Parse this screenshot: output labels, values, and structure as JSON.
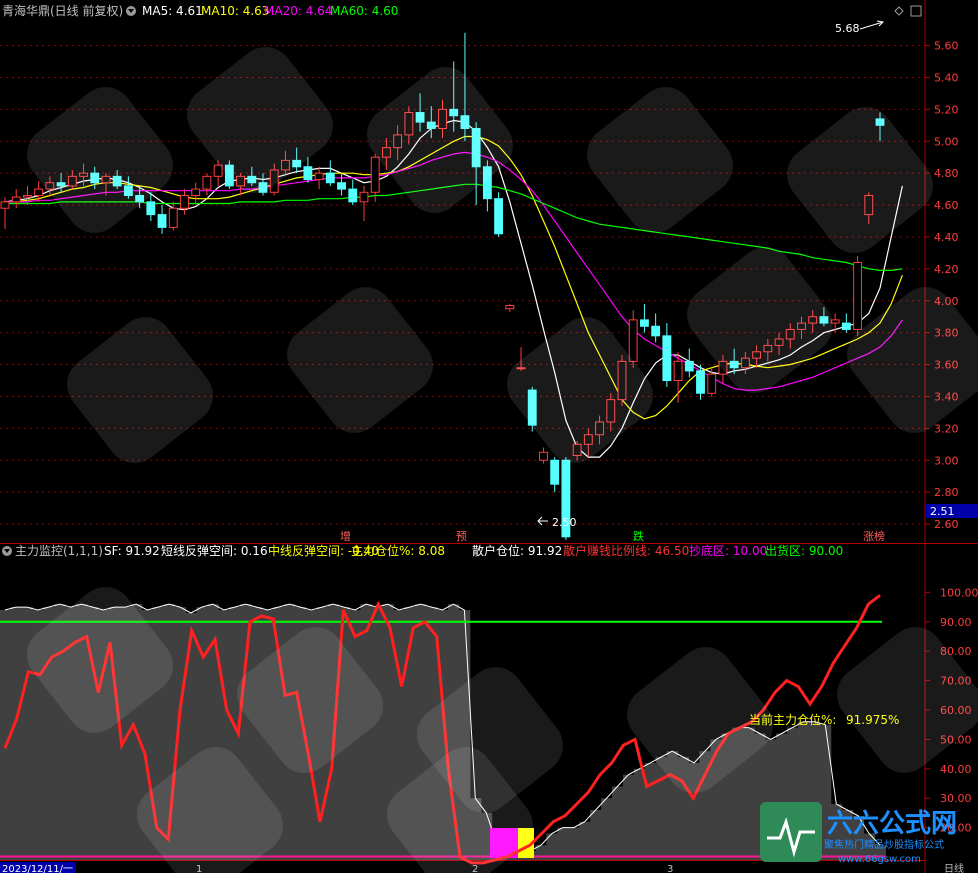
{
  "top_legend": {
    "title": "青海华鼎(日线 前复权)",
    "ma5": "MA5: 4.61",
    "ma10": "MA10: 4.63",
    "ma20": "MA20: 4.64",
    "ma60": "MA60: 4.60"
  },
  "price_panel": {
    "current_price_box": "2.51",
    "high_annotation": "5.68",
    "low_annotation": "2.50",
    "markers": [
      {
        "label": "增"
      },
      {
        "label": "预"
      },
      {
        "label": "跌"
      },
      {
        "label": "涨榜"
      }
    ]
  },
  "indicator_legend": {
    "name": "主力监控(1,1,1)",
    "sf": "SF: 91.92",
    "short_rebound": "短线反弹空间: 0.16",
    "mid_rebound": "中线反弹空间: -0.40",
    "main_position": "主力仓位%: 8.08",
    "retail_position": "散户仓位: 91.92",
    "retail_profit": "散户赚钱比例线: 46.50",
    "bottom_zone": "抄底区: 10.00",
    "sell_zone": "出货区: 90.00"
  },
  "indicator_panel": {
    "current_label": "当前主力仓位%:",
    "current_value": "91.975%"
  },
  "time_axis": {
    "start_date": "2023/12/11/一",
    "ticks": [
      "1",
      "2",
      "3"
    ],
    "period": "日线"
  },
  "brand": {
    "name": "六六公式网",
    "slogan": "聚焦热门精品炒股指标公式",
    "url": "www.66gsw.com"
  },
  "colors": {
    "up": "#ff3c3c",
    "down": "#54ffff",
    "ma5": "#ffffff",
    "ma10": "#ffff00",
    "ma20": "#ff00ff",
    "ma60": "#00ff00",
    "grid": "#8b0000"
  },
  "chart_data": [
    {
      "type": "candlestick",
      "title": "青海华鼎(日线 前复权)",
      "ylim": [
        2.5,
        5.7
      ],
      "yticks": [
        2.6,
        2.8,
        3.0,
        3.2,
        3.4,
        3.6,
        3.8,
        4.0,
        4.2,
        4.4,
        4.6,
        4.8,
        5.0,
        5.2,
        5.4,
        5.6
      ],
      "ohlc": [
        [
          4.58,
          4.65,
          4.45,
          4.62
        ],
        [
          4.62,
          4.7,
          4.58,
          4.65
        ],
        [
          4.65,
          4.72,
          4.6,
          4.66
        ],
        [
          4.66,
          4.75,
          4.62,
          4.7
        ],
        [
          4.7,
          4.78,
          4.65,
          4.74
        ],
        [
          4.74,
          4.8,
          4.68,
          4.72
        ],
        [
          4.72,
          4.82,
          4.7,
          4.78
        ],
        [
          4.78,
          4.86,
          4.72,
          4.8
        ],
        [
          4.8,
          4.84,
          4.7,
          4.74
        ],
        [
          4.74,
          4.8,
          4.66,
          4.78
        ],
        [
          4.78,
          4.82,
          4.7,
          4.72
        ],
        [
          4.72,
          4.78,
          4.64,
          4.66
        ],
        [
          4.66,
          4.72,
          4.58,
          4.62
        ],
        [
          4.62,
          4.68,
          4.5,
          4.54
        ],
        [
          4.54,
          4.6,
          4.42,
          4.46
        ],
        [
          4.46,
          4.62,
          4.44,
          4.58
        ],
        [
          4.58,
          4.7,
          4.54,
          4.66
        ],
        [
          4.66,
          4.74,
          4.6,
          4.7
        ],
        [
          4.7,
          4.8,
          4.66,
          4.78
        ],
        [
          4.78,
          4.88,
          4.72,
          4.85
        ],
        [
          4.85,
          4.88,
          4.7,
          4.72
        ],
        [
          4.72,
          4.8,
          4.66,
          4.78
        ],
        [
          4.78,
          4.84,
          4.72,
          4.74
        ],
        [
          4.74,
          4.8,
          4.66,
          4.68
        ],
        [
          4.68,
          4.86,
          4.66,
          4.82
        ],
        [
          4.82,
          4.94,
          4.78,
          4.88
        ],
        [
          4.88,
          4.96,
          4.8,
          4.84
        ],
        [
          4.84,
          4.9,
          4.74,
          4.76
        ],
        [
          4.76,
          4.84,
          4.7,
          4.8
        ],
        [
          4.8,
          4.88,
          4.72,
          4.74
        ],
        [
          4.74,
          4.8,
          4.66,
          4.7
        ],
        [
          4.7,
          4.76,
          4.6,
          4.62
        ],
        [
          4.62,
          4.72,
          4.5,
          4.68
        ],
        [
          4.68,
          4.92,
          4.62,
          4.9
        ],
        [
          4.9,
          5.02,
          4.82,
          4.96
        ],
        [
          4.96,
          5.1,
          4.88,
          5.04
        ],
        [
          5.04,
          5.22,
          4.98,
          5.18
        ],
        [
          5.18,
          5.3,
          5.06,
          5.12
        ],
        [
          5.12,
          5.22,
          5.02,
          5.08
        ],
        [
          5.08,
          5.26,
          5.02,
          5.2
        ],
        [
          5.2,
          5.5,
          5.06,
          5.16
        ],
        [
          5.16,
          5.68,
          5.0,
          5.08
        ],
        [
          5.08,
          5.12,
          4.6,
          4.84
        ],
        [
          4.84,
          4.88,
          4.56,
          4.64
        ],
        [
          4.64,
          4.68,
          4.4,
          4.42
        ],
        [
          3.95,
          3.98,
          3.93,
          3.97
        ],
        [
          3.58,
          3.71,
          3.56,
          3.58
        ],
        [
          3.44,
          3.46,
          3.18,
          3.22
        ],
        [
          3.0,
          3.08,
          2.98,
          3.05
        ],
        [
          3.0,
          3.02,
          2.8,
          2.85
        ],
        [
          3.0,
          3.02,
          2.5,
          2.52
        ],
        [
          3.03,
          3.12,
          3.0,
          3.1
        ],
        [
          3.1,
          3.2,
          3.02,
          3.16
        ],
        [
          3.16,
          3.28,
          3.1,
          3.24
        ],
        [
          3.24,
          3.42,
          3.18,
          3.38
        ],
        [
          3.38,
          3.66,
          3.34,
          3.62
        ],
        [
          3.62,
          3.94,
          3.58,
          3.88
        ],
        [
          3.88,
          3.98,
          3.8,
          3.84
        ],
        [
          3.84,
          3.92,
          3.74,
          3.78
        ],
        [
          3.78,
          3.86,
          3.46,
          3.5
        ],
        [
          3.5,
          3.68,
          3.36,
          3.62
        ],
        [
          3.62,
          3.7,
          3.52,
          3.56
        ],
        [
          3.56,
          3.6,
          3.38,
          3.42
        ],
        [
          3.42,
          3.58,
          3.4,
          3.54
        ],
        [
          3.54,
          3.66,
          3.48,
          3.62
        ],
        [
          3.62,
          3.7,
          3.54,
          3.58
        ],
        [
          3.58,
          3.68,
          3.54,
          3.64
        ],
        [
          3.64,
          3.72,
          3.58,
          3.68
        ],
        [
          3.68,
          3.76,
          3.62,
          3.72
        ],
        [
          3.72,
          3.8,
          3.66,
          3.76
        ],
        [
          3.76,
          3.86,
          3.7,
          3.82
        ],
        [
          3.82,
          3.9,
          3.76,
          3.86
        ],
        [
          3.86,
          3.94,
          3.8,
          3.9
        ],
        [
          3.9,
          3.96,
          3.84,
          3.86
        ],
        [
          3.86,
          3.92,
          3.8,
          3.88
        ],
        [
          3.86,
          3.92,
          3.8,
          3.82
        ],
        [
          3.82,
          4.28,
          3.78,
          4.24
        ],
        [
          4.54,
          4.68,
          4.48,
          4.66
        ],
        [
          5.14,
          5.18,
          5.0,
          5.1
        ]
      ],
      "series": [
        {
          "name": "MA5",
          "values": [
            4.62,
            4.63,
            4.64,
            4.66,
            4.69,
            4.71,
            4.73,
            4.75,
            4.76,
            4.77,
            4.76,
            4.74,
            4.71,
            4.67,
            4.62,
            4.58,
            4.57,
            4.59,
            4.64,
            4.71,
            4.75,
            4.76,
            4.77,
            4.76,
            4.77,
            4.79,
            4.81,
            4.82,
            4.83,
            4.83,
            4.8,
            4.77,
            4.74,
            4.75,
            4.78,
            4.84,
            4.92,
            5.02,
            5.08,
            5.11,
            5.13,
            5.12,
            5.06,
            4.96,
            4.84,
            4.62,
            4.36,
            4.1,
            3.82,
            3.55,
            3.25,
            3.08,
            3.02,
            3.02,
            3.09,
            3.2,
            3.36,
            3.51,
            3.61,
            3.66,
            3.66,
            3.62,
            3.58,
            3.55,
            3.54,
            3.56,
            3.57,
            3.59,
            3.61,
            3.63,
            3.66,
            3.71,
            3.75,
            3.8,
            3.82,
            3.84,
            3.86,
            3.92,
            4.08,
            4.4,
            4.72
          ]
        },
        {
          "name": "MA10",
          "values": [
            4.62,
            4.62,
            4.63,
            4.64,
            4.66,
            4.68,
            4.7,
            4.71,
            4.73,
            4.74,
            4.74,
            4.73,
            4.72,
            4.71,
            4.69,
            4.67,
            4.65,
            4.64,
            4.64,
            4.64,
            4.65,
            4.67,
            4.69,
            4.71,
            4.73,
            4.75,
            4.77,
            4.78,
            4.79,
            4.8,
            4.8,
            4.8,
            4.79,
            4.79,
            4.8,
            4.81,
            4.84,
            4.88,
            4.92,
            4.96,
            5.0,
            5.03,
            5.03,
            5.01,
            4.97,
            4.89,
            4.79,
            4.66,
            4.5,
            4.34,
            4.16,
            3.98,
            3.8,
            3.66,
            3.52,
            3.38,
            3.3,
            3.26,
            3.28,
            3.34,
            3.42,
            3.5,
            3.56,
            3.58,
            3.6,
            3.61,
            3.6,
            3.59,
            3.58,
            3.59,
            3.6,
            3.62,
            3.64,
            3.67,
            3.7,
            3.73,
            3.76,
            3.8,
            3.86,
            3.98,
            4.16
          ]
        },
        {
          "name": "MA20",
          "values": [
            4.62,
            4.62,
            4.62,
            4.63,
            4.63,
            4.64,
            4.65,
            4.66,
            4.67,
            4.68,
            4.68,
            4.69,
            4.69,
            4.69,
            4.69,
            4.69,
            4.69,
            4.69,
            4.69,
            4.69,
            4.69,
            4.7,
            4.7,
            4.71,
            4.72,
            4.73,
            4.74,
            4.75,
            4.76,
            4.77,
            4.77,
            4.77,
            4.77,
            4.78,
            4.79,
            4.81,
            4.83,
            4.85,
            4.88,
            4.9,
            4.92,
            4.93,
            4.92,
            4.9,
            4.87,
            4.82,
            4.76,
            4.69,
            4.6,
            4.5,
            4.4,
            4.3,
            4.2,
            4.1,
            4.0,
            3.9,
            3.82,
            3.76,
            3.72,
            3.68,
            3.64,
            3.6,
            3.56,
            3.52,
            3.48,
            3.45,
            3.44,
            3.44,
            3.45,
            3.46,
            3.48,
            3.5,
            3.52,
            3.55,
            3.58,
            3.61,
            3.64,
            3.67,
            3.71,
            3.78,
            3.88
          ]
        },
        {
          "name": "MA60",
          "values": [
            4.61,
            4.61,
            4.61,
            4.61,
            4.61,
            4.62,
            4.62,
            4.62,
            4.62,
            4.62,
            4.62,
            4.62,
            4.62,
            4.61,
            4.61,
            4.61,
            4.61,
            4.61,
            4.61,
            4.61,
            4.61,
            4.62,
            4.62,
            4.62,
            4.62,
            4.63,
            4.63,
            4.63,
            4.64,
            4.64,
            4.64,
            4.65,
            4.65,
            4.66,
            4.66,
            4.67,
            4.68,
            4.69,
            4.7,
            4.71,
            4.72,
            4.73,
            4.73,
            4.72,
            4.71,
            4.69,
            4.67,
            4.64,
            4.61,
            4.58,
            4.55,
            4.52,
            4.5,
            4.48,
            4.47,
            4.46,
            4.45,
            4.44,
            4.43,
            4.42,
            4.41,
            4.4,
            4.39,
            4.38,
            4.37,
            4.36,
            4.35,
            4.34,
            4.33,
            4.31,
            4.3,
            4.29,
            4.27,
            4.26,
            4.25,
            4.24,
            4.22,
            4.2,
            4.19,
            4.19,
            4.2
          ]
        }
      ]
    },
    {
      "type": "area",
      "title": "主力监控(1,1,1)",
      "ylim": [
        10,
        102
      ],
      "yticks": [
        20,
        30,
        40,
        50,
        60,
        70,
        80,
        90,
        100
      ],
      "sell_line": 90,
      "bottom_line": 10,
      "series": [
        {
          "name": "散户仓位",
          "values": [
            94,
            95,
            95,
            94,
            95,
            96,
            95,
            96,
            95,
            94,
            95,
            95,
            96,
            94,
            95,
            96,
            95,
            93,
            95,
            96,
            94,
            95,
            96,
            95,
            94,
            95,
            96,
            95,
            94,
            95,
            96,
            95,
            94,
            96,
            95,
            96,
            94,
            95,
            96,
            95,
            94,
            96,
            94,
            30,
            25,
            14,
            12,
            12,
            12,
            14,
            18,
            20,
            20,
            22,
            26,
            30,
            34,
            38,
            40,
            42,
            44,
            46,
            44,
            42,
            46,
            50,
            52,
            54,
            54,
            52,
            50,
            52,
            54,
            56,
            56,
            55,
            28,
            26,
            24,
            18,
            14
          ]
        },
        {
          "name": "主力仓位%",
          "values": [
            47,
            57,
            73,
            72,
            78,
            80,
            83,
            85,
            66,
            83,
            48,
            55,
            45,
            20,
            16,
            60,
            87,
            78,
            84,
            60,
            52,
            90,
            92,
            91,
            65,
            66,
            45,
            22,
            40,
            94,
            85,
            87,
            96,
            88,
            68,
            88,
            90,
            85,
            40,
            10,
            8,
            8,
            9,
            10,
            12,
            14,
            18,
            22,
            24,
            28,
            32,
            38,
            42,
            48,
            50,
            34,
            36,
            38,
            36,
            30,
            38,
            46,
            52,
            54,
            56,
            60,
            66,
            70,
            68,
            62,
            68,
            76,
            82,
            88,
            96,
            99
          ]
        }
      ]
    }
  ]
}
